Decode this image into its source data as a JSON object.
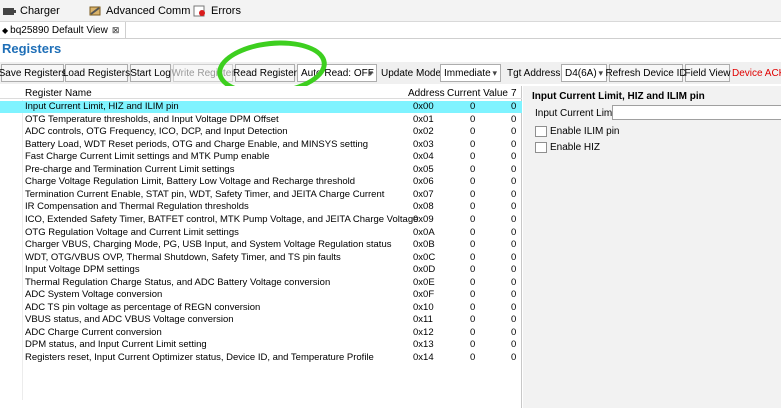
{
  "top_tabs": [
    {
      "label": "Charger",
      "icon": "charger-icon"
    },
    {
      "label": "Advanced Comm",
      "icon": "wrench-icon"
    },
    {
      "label": "Errors",
      "icon": "error-icon"
    }
  ],
  "view_tab": {
    "label": "bq25890 Default View",
    "close": "⊠"
  },
  "section_title": "Registers",
  "toolbar": {
    "save_registers": "Save Registers",
    "load_registers": "Load Registers",
    "start_log": "Start Log",
    "write_register": "Write Register",
    "read_register": "Read Register",
    "auto_read": "Auto Read: OFF",
    "update_mode_label": "Update Mode",
    "update_mode_value": "Immediate",
    "tgt_address_label": "Tgt Address",
    "tgt_address_value": "D4(6A)",
    "refresh_device_id": "Refresh Device ID",
    "field_view": "Field View",
    "device_ack": "Device ACK I"
  },
  "table": {
    "columns": [
      "Register Name",
      "Address",
      "Current Value",
      "7"
    ],
    "rows": [
      {
        "name": "Input Current Limit, HIZ and ILIM pin",
        "address": "0x00",
        "value": "0",
        "bit7": "0"
      },
      {
        "name": "OTG Temperature thresholds, and Input Voltage DPM Offset",
        "address": "0x01",
        "value": "0",
        "bit7": "0"
      },
      {
        "name": "ADC controls, OTG Frequency, ICO, DCP, and Input Detection",
        "address": "0x02",
        "value": "0",
        "bit7": "0"
      },
      {
        "name": "Battery Load, WDT Reset periods, OTG and Charge Enable, and MINSYS setting",
        "address": "0x03",
        "value": "0",
        "bit7": "0"
      },
      {
        "name": "Fast Charge Current Limit settings and MTK Pump enable",
        "address": "0x04",
        "value": "0",
        "bit7": "0"
      },
      {
        "name": "Pre-charge and Termination Current Limit settings",
        "address": "0x05",
        "value": "0",
        "bit7": "0"
      },
      {
        "name": "Charge Voltage Regulation Limit, Battery Low Voltage and Recharge threshold",
        "address": "0x06",
        "value": "0",
        "bit7": "0"
      },
      {
        "name": "Termination Current Enable, STAT pin, WDT, Safety Timer, and JEITA Charge Current",
        "address": "0x07",
        "value": "0",
        "bit7": "0"
      },
      {
        "name": "IR Compensation and Thermal Regulation thresholds",
        "address": "0x08",
        "value": "0",
        "bit7": "0"
      },
      {
        "name": "ICO, Extended Safety Timer, BATFET control, MTK Pump Voltage, and JEITA Charge Voltage",
        "address": "0x09",
        "value": "0",
        "bit7": "0"
      },
      {
        "name": "OTG Regulation Voltage and Current Limit settings",
        "address": "0x0A",
        "value": "0",
        "bit7": "0"
      },
      {
        "name": "Charger VBUS, Charging Mode, PG, USB Input, and System Voltage Regulation status",
        "address": "0x0B",
        "value": "0",
        "bit7": "0"
      },
      {
        "name": "WDT, OTG/VBUS OVP, Thermal Shutdown, Safety Timer, and TS pin faults",
        "address": "0x0C",
        "value": "0",
        "bit7": "0"
      },
      {
        "name": "Input Voltage DPM settings",
        "address": "0x0D",
        "value": "0",
        "bit7": "0"
      },
      {
        "name": "Thermal Regulation Charge Status, and ADC Battery Voltage conversion",
        "address": "0x0E",
        "value": "0",
        "bit7": "0"
      },
      {
        "name": "ADC System Voltage conversion",
        "address": "0x0F",
        "value": "0",
        "bit7": "0"
      },
      {
        "name": "ADC TS pin voltage as percentage of REGN conversion",
        "address": "0x10",
        "value": "0",
        "bit7": "0"
      },
      {
        "name": "VBUS status, and ADC VBUS Voltage conversion",
        "address": "0x11",
        "value": "0",
        "bit7": "0"
      },
      {
        "name": "ADC Charge Current conversion",
        "address": "0x12",
        "value": "0",
        "bit7": "0"
      },
      {
        "name": "DPM status, and Input Current Limit setting",
        "address": "0x13",
        "value": "0",
        "bit7": "0"
      },
      {
        "name": "Registers reset, Input Current Optimizer status, Device ID, and Temperature Profile",
        "address": "0x14",
        "value": "0",
        "bit7": "0"
      }
    ]
  },
  "detail": {
    "title": "Input Current Limit, HIZ and ILIM pin",
    "input_current_limit_label": "Input Current Limit",
    "input_current_limit_value": "",
    "enable_ilim_label": "Enable ILIM pin",
    "enable_hiz_label": "Enable HIZ"
  },
  "colors": {
    "accent": "#1f6fb7",
    "selection": "#7ff3ff",
    "highlight_ring": "#3dcf1f",
    "device_ack": "#e00000"
  }
}
